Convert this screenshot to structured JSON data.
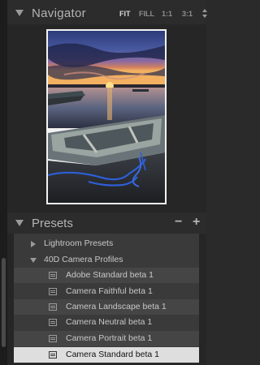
{
  "navigator": {
    "title": "Navigator",
    "zoom_options": [
      "FIT",
      "FILL",
      "1:1",
      "3:1"
    ],
    "active_zoom": "FIT"
  },
  "presets": {
    "title": "Presets",
    "remove_label": "−",
    "add_label": "+",
    "folders": [
      {
        "label": "Lightroom Presets",
        "expanded": false
      },
      {
        "label": "40D Camera Profiles",
        "expanded": true
      }
    ],
    "items": [
      {
        "label": "Adobe Standard beta 1"
      },
      {
        "label": "Camera Faithful beta 1"
      },
      {
        "label": "Camera Landscape beta 1"
      },
      {
        "label": "Camera Neutral beta 1"
      },
      {
        "label": "Camera Portrait beta 1"
      },
      {
        "label": "Camera Standard beta 1"
      }
    ],
    "selected_item": "Camera Standard beta 1"
  }
}
